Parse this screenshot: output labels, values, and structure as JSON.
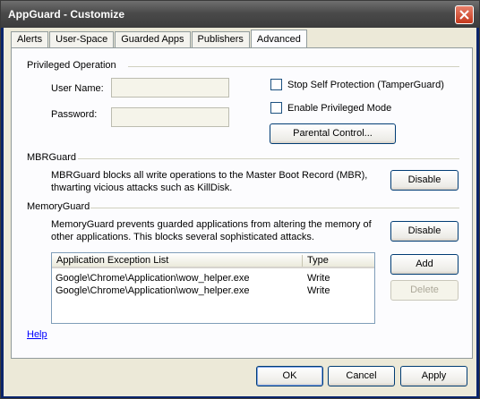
{
  "window": {
    "title": "AppGuard - Customize"
  },
  "tabs": [
    {
      "label": "Alerts"
    },
    {
      "label": "User-Space"
    },
    {
      "label": "Guarded Apps"
    },
    {
      "label": "Publishers"
    },
    {
      "label": "Advanced"
    }
  ],
  "active_tab": "Advanced",
  "privileged": {
    "group_label": "Privileged Operation",
    "username_label": "User Name:",
    "username_value": "",
    "password_label": "Password:",
    "password_value": "",
    "stop_self_protection_label": "Stop Self Protection (TamperGuard)",
    "stop_self_protection_checked": false,
    "enable_privileged_label": "Enable Privileged Mode",
    "enable_privileged_checked": false,
    "parental_control_label": "Parental Control..."
  },
  "mbrguard": {
    "group_label": "MBRGuard",
    "description_line1": "MBRGuard blocks all write operations to the Master Boot Record (MBR),",
    "description_line2": "thwarting vicious attacks such as KillDisk.",
    "disable_label": "Disable"
  },
  "memoryguard": {
    "group_label": "MemoryGuard",
    "description_line1": "MemoryGuard prevents guarded applications from altering the memory of",
    "description_line2": "other applications. This blocks several sophisticated attacks.",
    "disable_label": "Disable",
    "add_label": "Add",
    "delete_label": "Delete",
    "list": {
      "columns": [
        "Application Exception List",
        "Type"
      ],
      "rows": [
        {
          "app": "Google\\Chrome\\Application\\wow_helper.exe",
          "type": "Write"
        },
        {
          "app": "Google\\Chrome\\Application\\wow_helper.exe",
          "type": "Write"
        }
      ]
    }
  },
  "help_label": "Help",
  "footer": {
    "ok_label": "OK",
    "cancel_label": "Cancel",
    "apply_label": "Apply"
  },
  "colors": {
    "link": "#0000ff",
    "close_button": "#c4381c"
  }
}
